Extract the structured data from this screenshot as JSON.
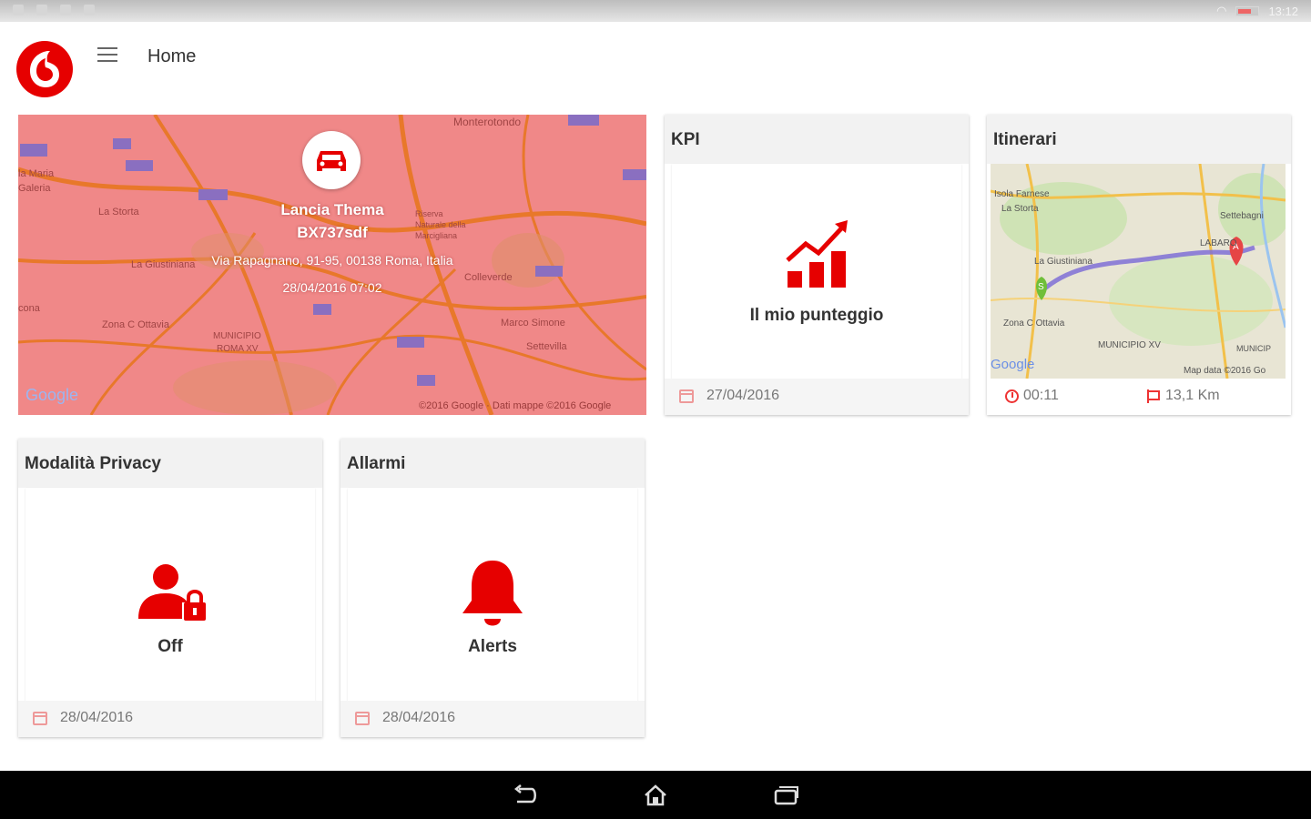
{
  "status_bar": {
    "time": "13:12"
  },
  "app_bar": {
    "title": "Home",
    "menu_icon": "hamburger-menu-icon",
    "logo": "vodafone-logo"
  },
  "map_card": {
    "vehicle_name": "Lancia Thema",
    "vehicle_plate": "BX737sdf",
    "address": "Via Rapagnano, 91-95, 00138 Roma, Italia",
    "timestamp": "28/04/2016 07:02",
    "google_logo": "Google",
    "copyright": "©2016 Google · Dati mappe ©2016 Google",
    "pin_icon": "car-icon"
  },
  "kpi_card": {
    "title": "KPI",
    "label": "Il mio punteggio",
    "date": "27/04/2016",
    "icon": "chart-growth-icon"
  },
  "itinerari_card": {
    "title": "Itinerari",
    "duration": "00:11",
    "distance": "13,1 Km",
    "google_logo": "Google",
    "map_data": "Map data ©2016 Go"
  },
  "privacy_card": {
    "title": "Modalità Privacy",
    "label": "Off",
    "date": "28/04/2016",
    "icon": "user-lock-icon"
  },
  "alarm_card": {
    "title": "Allarmi",
    "label": "Alerts",
    "date": "28/04/2016",
    "icon": "bell-icon"
  },
  "colors": {
    "brand": "#e60000",
    "map_tint": "#f08080"
  }
}
